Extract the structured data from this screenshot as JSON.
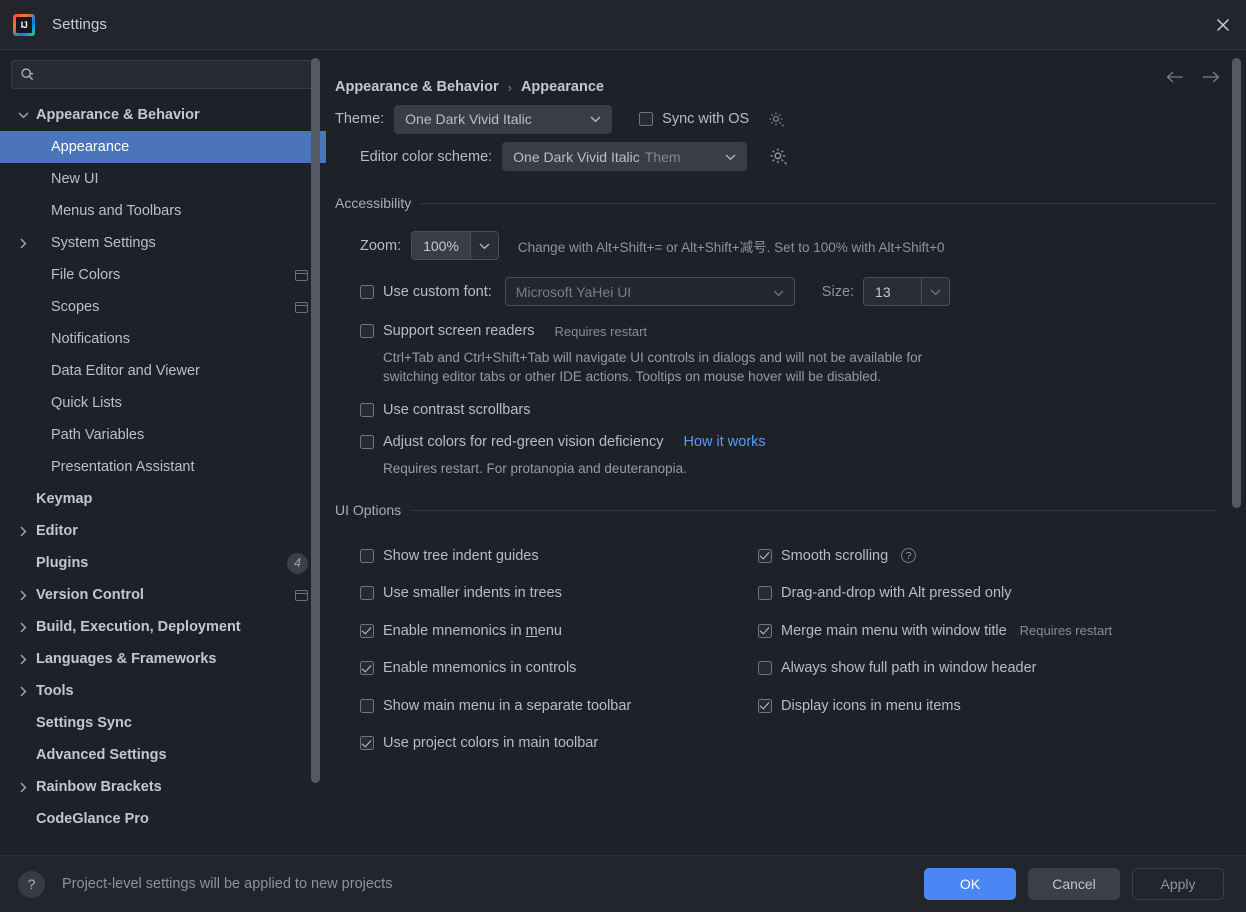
{
  "window": {
    "title": "Settings",
    "logo_icon": "intellij-idea-logo",
    "close_icon": "close-icon"
  },
  "sidebar": {
    "search": {
      "placeholder": "",
      "value": "",
      "icon": "search-icon"
    },
    "items": [
      {
        "label": "Appearance & Behavior",
        "level": 0,
        "arrow": "expanded",
        "group": true,
        "selected": false
      },
      {
        "label": "Appearance",
        "level": 1,
        "arrow": "none",
        "group": false,
        "selected": true
      },
      {
        "label": "New UI",
        "level": 1,
        "arrow": "none",
        "group": false,
        "selected": false
      },
      {
        "label": "Menus and Toolbars",
        "level": 1,
        "arrow": "none",
        "group": false,
        "selected": false
      },
      {
        "label": "System Settings",
        "level": 1,
        "arrow": "collapsed",
        "group": false,
        "selected": false
      },
      {
        "label": "File Colors",
        "level": 1,
        "arrow": "none",
        "group": false,
        "selected": false,
        "project_icon": true
      },
      {
        "label": "Scopes",
        "level": 1,
        "arrow": "none",
        "group": false,
        "selected": false,
        "project_icon": true
      },
      {
        "label": "Notifications",
        "level": 1,
        "arrow": "none",
        "group": false,
        "selected": false
      },
      {
        "label": "Data Editor and Viewer",
        "level": 1,
        "arrow": "none",
        "group": false,
        "selected": false
      },
      {
        "label": "Quick Lists",
        "level": 1,
        "arrow": "none",
        "group": false,
        "selected": false
      },
      {
        "label": "Path Variables",
        "level": 1,
        "arrow": "none",
        "group": false,
        "selected": false
      },
      {
        "label": "Presentation Assistant",
        "level": 1,
        "arrow": "none",
        "group": false,
        "selected": false
      },
      {
        "label": "Keymap",
        "level": 0,
        "arrow": "none",
        "group": true,
        "selected": false
      },
      {
        "label": "Editor",
        "level": 0,
        "arrow": "collapsed",
        "group": true,
        "selected": false
      },
      {
        "label": "Plugins",
        "level": 0,
        "arrow": "none",
        "group": true,
        "selected": false,
        "badge": "4"
      },
      {
        "label": "Version Control",
        "level": 0,
        "arrow": "collapsed",
        "group": true,
        "selected": false,
        "project_icon": true
      },
      {
        "label": "Build, Execution, Deployment",
        "level": 0,
        "arrow": "collapsed",
        "group": true,
        "selected": false
      },
      {
        "label": "Languages & Frameworks",
        "level": 0,
        "arrow": "collapsed",
        "group": true,
        "selected": false
      },
      {
        "label": "Tools",
        "level": 0,
        "arrow": "collapsed",
        "group": true,
        "selected": false
      },
      {
        "label": "Settings Sync",
        "level": 0,
        "arrow": "none",
        "group": true,
        "selected": false
      },
      {
        "label": "Advanced Settings",
        "level": 0,
        "arrow": "none",
        "group": true,
        "selected": false
      },
      {
        "label": "Rainbow Brackets",
        "level": 0,
        "arrow": "collapsed",
        "group": true,
        "selected": false
      },
      {
        "label": "CodeGlance Pro",
        "level": 0,
        "arrow": "none",
        "group": true,
        "selected": false
      }
    ]
  },
  "breadcrumb": {
    "parent": "Appearance & Behavior",
    "separator": "›",
    "current": "Appearance",
    "back_icon": "arrow-left-icon",
    "forward_icon": "arrow-right-icon"
  },
  "theme": {
    "label": "Theme:",
    "value": "One Dark Vivid Italic",
    "sync_label": "Sync with OS",
    "sync_checked": false,
    "gear_icon": "gear-icon",
    "scheme_label": "Editor color scheme:",
    "scheme_value": "One Dark Vivid Italic",
    "scheme_value_dim": "Them",
    "scheme_gear_icon": "gear-icon"
  },
  "accessibility": {
    "title": "Accessibility",
    "zoom_label": "Zoom:",
    "zoom_value": "100%",
    "zoom_hint": "Change with Alt+Shift+= or Alt+Shift+减号. Set to 100% with Alt+Shift+0",
    "custom_font_label": "Use custom font:",
    "custom_font_checked": false,
    "custom_font_value": "Microsoft YaHei UI",
    "size_label": "Size:",
    "size_value": "13",
    "screen_readers_label": "Support screen readers",
    "screen_readers_checked": false,
    "screen_readers_hint": "Requires restart",
    "screen_readers_desc": "Ctrl+Tab and Ctrl+Shift+Tab will navigate UI controls in dialogs and will not be available for switching editor tabs or other IDE actions. Tooltips on mouse hover will be disabled.",
    "contrast_scrollbars_label": "Use contrast scrollbars",
    "contrast_scrollbars_checked": false,
    "redgreen_label": "Adjust colors for red-green vision deficiency",
    "redgreen_checked": false,
    "redgreen_link": "How it works",
    "redgreen_desc": "Requires restart. For protanopia and deuteranopia."
  },
  "ui_options": {
    "title": "UI Options",
    "left": [
      {
        "label": "Show tree indent guides",
        "checked": false
      },
      {
        "label": "Use smaller indents in trees",
        "checked": false
      },
      {
        "label": "Enable mnemonics in menu",
        "checked": true,
        "mnemonic": "m"
      },
      {
        "label": "Enable mnemonics in controls",
        "checked": true
      },
      {
        "label": "Show main menu in a separate toolbar",
        "checked": false
      },
      {
        "label": "Use project colors in main toolbar",
        "checked": true
      }
    ],
    "right": [
      {
        "label": "Smooth scrolling",
        "checked": true,
        "help": true
      },
      {
        "label": "Drag-and-drop with Alt pressed only",
        "checked": false
      },
      {
        "label": "Merge main menu with window title",
        "checked": true,
        "hint": "Requires restart"
      },
      {
        "label": "Always show full path in window header",
        "checked": false
      },
      {
        "label": "Display icons in menu items",
        "checked": true
      }
    ]
  },
  "footer": {
    "help_icon": "question-mark-icon",
    "note": "Project-level settings will be applied to new projects",
    "ok": "OK",
    "cancel": "Cancel",
    "apply": "Apply"
  },
  "colors": {
    "background": "#1e2128",
    "titlebar": "#22252c",
    "selection": "#4a74bc",
    "accent_button": "#4a87f5",
    "link": "#5b9bf0",
    "text": "#b6bdc7",
    "text_dim": "#858d99"
  }
}
